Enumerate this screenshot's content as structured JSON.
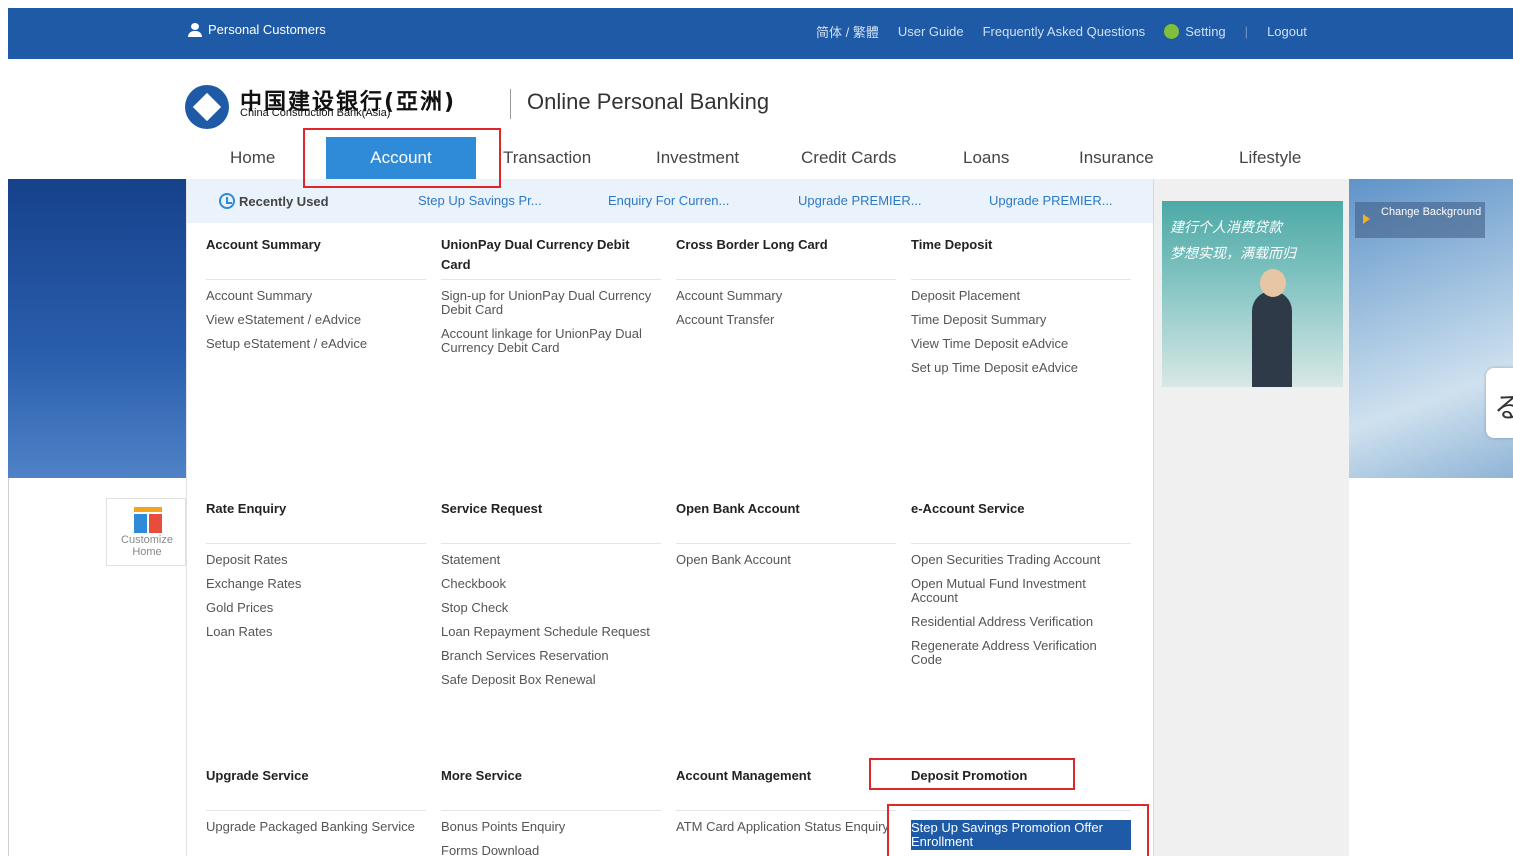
{
  "topbar": {
    "personal": "Personal Customers",
    "lang": "简体 / 繁體",
    "user_guide": "User Guide",
    "faq": "Frequently Asked Questions",
    "setting": "Setting",
    "sep": "|",
    "logout": "Logout"
  },
  "brand": {
    "cn": "中国建设银行(亞洲)",
    "en": "China Construction Bank(Asia)",
    "title": "Online Personal Banking"
  },
  "nav": [
    "Home",
    "Account",
    "Transaction",
    "Investment",
    "Credit Cards",
    "Loans",
    "Insurance",
    "Lifestyle"
  ],
  "recent": {
    "label": "Recently Used",
    "links": [
      "Step Up Savings Pr...",
      "Enquiry For Curren...",
      "Upgrade PREMIER...",
      "Upgrade PREMIER..."
    ]
  },
  "sections": [
    {
      "title": "Account Summary",
      "links": [
        "Account Summary",
        "View eStatement / eAdvice",
        "Setup eStatement / eAdvice"
      ]
    },
    {
      "title": "UnionPay Dual Currency Debit Card",
      "links": [
        "Sign-up for UnionPay Dual Currency Debit Card",
        "Account linkage for UnionPay Dual Currency Debit Card"
      ]
    },
    {
      "title": "Cross Border Long Card",
      "links": [
        "Account Summary",
        "Account Transfer"
      ]
    },
    {
      "title": "Time Deposit",
      "links": [
        "Deposit Placement",
        "Time Deposit Summary",
        "View Time Deposit eAdvice",
        "Set up Time Deposit eAdvice"
      ]
    },
    {
      "title": "Rate Enquiry",
      "links": [
        "Deposit Rates",
        "Exchange Rates",
        "Gold Prices",
        "Loan Rates"
      ]
    },
    {
      "title": "Service Request",
      "links": [
        "Statement",
        "Checkbook",
        "Stop Check",
        "Loan Repayment Schedule Request",
        "Branch Services Reservation",
        "Safe Deposit Box Renewal"
      ]
    },
    {
      "title": "Open Bank Account",
      "links": [
        "Open Bank Account"
      ]
    },
    {
      "title": "e-Account Service",
      "links": [
        "Open Securities Trading Account",
        "Open Mutual Fund Investment Account",
        "Residential Address Verification",
        "Regenerate Address Verification Code"
      ]
    },
    {
      "title": "Upgrade Service",
      "links": [
        "Upgrade Packaged Banking Service"
      ]
    },
    {
      "title": "More Service",
      "links": [
        "Bonus Points Enquiry",
        "Forms Download"
      ]
    },
    {
      "title": "Account Management",
      "links": [
        "ATM Card Application Status Enquiry"
      ]
    },
    {
      "title": "Deposit Promotion",
      "links": [
        "Step Up Savings Promotion Offer Enrollment"
      ]
    }
  ],
  "ad": {
    "line1": "建行个人消费贷款",
    "line2": "梦想实现，满载而归"
  },
  "change_bg": "Change Background",
  "customize": "Customize Home",
  "side_char": "る",
  "colors": {
    "topbar": "#1e5aa6",
    "active_tab": "#2f8ad8",
    "highlight": "#e0262b"
  }
}
